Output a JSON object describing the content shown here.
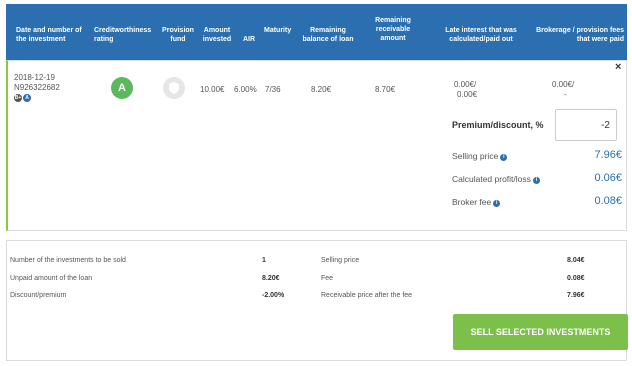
{
  "headers": {
    "date_number": "Date and number of the investment",
    "creditworthiness": "Creditworthiness rating",
    "provision_fund": "Provision fund",
    "amount_invested": "Amount invested",
    "air": "AIR",
    "maturity": "Maturity",
    "remaining_balance": "Remaining balance of loan",
    "remaining_receivable": "Remaining receivable amount",
    "late_interest": "Late interest that was calculated/paid out",
    "brokerage_fees": "Brokerage / provision fees that were paid"
  },
  "investment": {
    "date": "2018-12-19",
    "number": "N926322682",
    "rating": "A",
    "amount_invested": "10.00€",
    "air": "6.00%",
    "maturity": "7/36",
    "remaining_balance": "8.20€",
    "remaining_receivable": "8.70€",
    "late_interest_1": "0.00€/",
    "late_interest_2": "0.00€",
    "brokerage_1": "0.00€/",
    "brokerage_2": "-",
    "mini_icon_1": "B+",
    "mini_icon_2": "A",
    "close": "×"
  },
  "pricing": {
    "premium_label": "Premium/discount, %",
    "premium_value": "-2",
    "selling_price_label": "Selling price",
    "selling_price_value": "7.96€",
    "profit_label": "Calculated profit/loss",
    "profit_value": "0.06€",
    "broker_fee_label": "Broker fee",
    "broker_fee_value": "0.08€"
  },
  "summary": {
    "num_investments_label": "Number of the investments to be sold",
    "num_investments_value": "1",
    "unpaid_label": "Unpaid amount of the loan",
    "unpaid_value": "8.20€",
    "discount_label": "Discount/premium",
    "discount_value": "-2.00%",
    "selling_price_label": "Selling price",
    "selling_price_value": "8.04€",
    "fee_label": "Fee",
    "fee_value": "0.08€",
    "receivable_label": "Receivable price after the fee",
    "receivable_value": "7.96€",
    "sell_button": "SELL SELECTED INVESTMENTS"
  },
  "colors": {
    "header_bg": "#2b6fb1",
    "rating_green": "#5cb85c",
    "button_green": "#7cbf4a",
    "accent_blue": "#2b6fb1",
    "row_left_border": "#8cc63f"
  }
}
